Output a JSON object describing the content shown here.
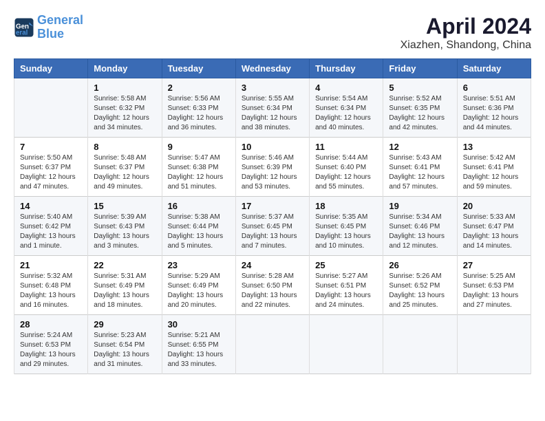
{
  "logo": {
    "line1": "General",
    "line2": "Blue"
  },
  "title": "April 2024",
  "subtitle": "Xiazhen, Shandong, China",
  "weekdays": [
    "Sunday",
    "Monday",
    "Tuesday",
    "Wednesday",
    "Thursday",
    "Friday",
    "Saturday"
  ],
  "weeks": [
    [
      {
        "day": "",
        "info": ""
      },
      {
        "day": "1",
        "info": "Sunrise: 5:58 AM\nSunset: 6:32 PM\nDaylight: 12 hours\nand 34 minutes."
      },
      {
        "day": "2",
        "info": "Sunrise: 5:56 AM\nSunset: 6:33 PM\nDaylight: 12 hours\nand 36 minutes."
      },
      {
        "day": "3",
        "info": "Sunrise: 5:55 AM\nSunset: 6:34 PM\nDaylight: 12 hours\nand 38 minutes."
      },
      {
        "day": "4",
        "info": "Sunrise: 5:54 AM\nSunset: 6:34 PM\nDaylight: 12 hours\nand 40 minutes."
      },
      {
        "day": "5",
        "info": "Sunrise: 5:52 AM\nSunset: 6:35 PM\nDaylight: 12 hours\nand 42 minutes."
      },
      {
        "day": "6",
        "info": "Sunrise: 5:51 AM\nSunset: 6:36 PM\nDaylight: 12 hours\nand 44 minutes."
      }
    ],
    [
      {
        "day": "7",
        "info": "Sunrise: 5:50 AM\nSunset: 6:37 PM\nDaylight: 12 hours\nand 47 minutes."
      },
      {
        "day": "8",
        "info": "Sunrise: 5:48 AM\nSunset: 6:37 PM\nDaylight: 12 hours\nand 49 minutes."
      },
      {
        "day": "9",
        "info": "Sunrise: 5:47 AM\nSunset: 6:38 PM\nDaylight: 12 hours\nand 51 minutes."
      },
      {
        "day": "10",
        "info": "Sunrise: 5:46 AM\nSunset: 6:39 PM\nDaylight: 12 hours\nand 53 minutes."
      },
      {
        "day": "11",
        "info": "Sunrise: 5:44 AM\nSunset: 6:40 PM\nDaylight: 12 hours\nand 55 minutes."
      },
      {
        "day": "12",
        "info": "Sunrise: 5:43 AM\nSunset: 6:41 PM\nDaylight: 12 hours\nand 57 minutes."
      },
      {
        "day": "13",
        "info": "Sunrise: 5:42 AM\nSunset: 6:41 PM\nDaylight: 12 hours\nand 59 minutes."
      }
    ],
    [
      {
        "day": "14",
        "info": "Sunrise: 5:40 AM\nSunset: 6:42 PM\nDaylight: 13 hours\nand 1 minute."
      },
      {
        "day": "15",
        "info": "Sunrise: 5:39 AM\nSunset: 6:43 PM\nDaylight: 13 hours\nand 3 minutes."
      },
      {
        "day": "16",
        "info": "Sunrise: 5:38 AM\nSunset: 6:44 PM\nDaylight: 13 hours\nand 5 minutes."
      },
      {
        "day": "17",
        "info": "Sunrise: 5:37 AM\nSunset: 6:45 PM\nDaylight: 13 hours\nand 7 minutes."
      },
      {
        "day": "18",
        "info": "Sunrise: 5:35 AM\nSunset: 6:45 PM\nDaylight: 13 hours\nand 10 minutes."
      },
      {
        "day": "19",
        "info": "Sunrise: 5:34 AM\nSunset: 6:46 PM\nDaylight: 13 hours\nand 12 minutes."
      },
      {
        "day": "20",
        "info": "Sunrise: 5:33 AM\nSunset: 6:47 PM\nDaylight: 13 hours\nand 14 minutes."
      }
    ],
    [
      {
        "day": "21",
        "info": "Sunrise: 5:32 AM\nSunset: 6:48 PM\nDaylight: 13 hours\nand 16 minutes."
      },
      {
        "day": "22",
        "info": "Sunrise: 5:31 AM\nSunset: 6:49 PM\nDaylight: 13 hours\nand 18 minutes."
      },
      {
        "day": "23",
        "info": "Sunrise: 5:29 AM\nSunset: 6:49 PM\nDaylight: 13 hours\nand 20 minutes."
      },
      {
        "day": "24",
        "info": "Sunrise: 5:28 AM\nSunset: 6:50 PM\nDaylight: 13 hours\nand 22 minutes."
      },
      {
        "day": "25",
        "info": "Sunrise: 5:27 AM\nSunset: 6:51 PM\nDaylight: 13 hours\nand 24 minutes."
      },
      {
        "day": "26",
        "info": "Sunrise: 5:26 AM\nSunset: 6:52 PM\nDaylight: 13 hours\nand 25 minutes."
      },
      {
        "day": "27",
        "info": "Sunrise: 5:25 AM\nSunset: 6:53 PM\nDaylight: 13 hours\nand 27 minutes."
      }
    ],
    [
      {
        "day": "28",
        "info": "Sunrise: 5:24 AM\nSunset: 6:53 PM\nDaylight: 13 hours\nand 29 minutes."
      },
      {
        "day": "29",
        "info": "Sunrise: 5:23 AM\nSunset: 6:54 PM\nDaylight: 13 hours\nand 31 minutes."
      },
      {
        "day": "30",
        "info": "Sunrise: 5:21 AM\nSunset: 6:55 PM\nDaylight: 13 hours\nand 33 minutes."
      },
      {
        "day": "",
        "info": ""
      },
      {
        "day": "",
        "info": ""
      },
      {
        "day": "",
        "info": ""
      },
      {
        "day": "",
        "info": ""
      }
    ]
  ]
}
